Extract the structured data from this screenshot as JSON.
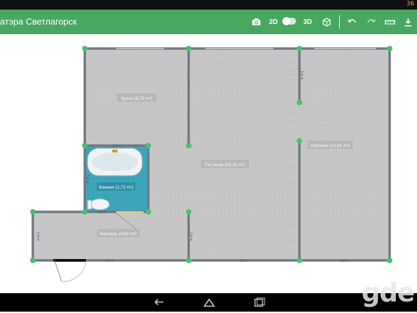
{
  "status_bar": {
    "clock": "36"
  },
  "toolbar": {
    "title": "атэра Светлагорск",
    "mode_2d": "2D",
    "mode_3d": "3D",
    "icons": [
      "camera-icon",
      "view-toggle",
      "cube-icon",
      "undo-icon",
      "redo-icon",
      "ruler-icon",
      "download-icon"
    ]
  },
  "rooms": {
    "kitchen": "Кухня (8,75 m²)",
    "bathroom": "Ванная (2,72 m²)",
    "corridor": "Коридор (4,92 m²)",
    "living": "Гостиная (16,25 m²)",
    "bedroom": "Спальня (12,91 m²)"
  },
  "dimensions": {
    "d1": "1,4 m",
    "d2": "4,7 m",
    "d3": "3,6 m",
    "d4": "3,3 m",
    "d5": "2,3 m",
    "d6": "1,6 m",
    "d7": "1,5 m",
    "d8": "0,9 m",
    "d9": "1,4 m"
  },
  "colors": {
    "toolbar": "#48a860",
    "floor": "#c9c9c9",
    "bathroom": "#3aa3b8",
    "wall": "#6f7a80",
    "node": "#4cbf72"
  },
  "watermark": "gde"
}
